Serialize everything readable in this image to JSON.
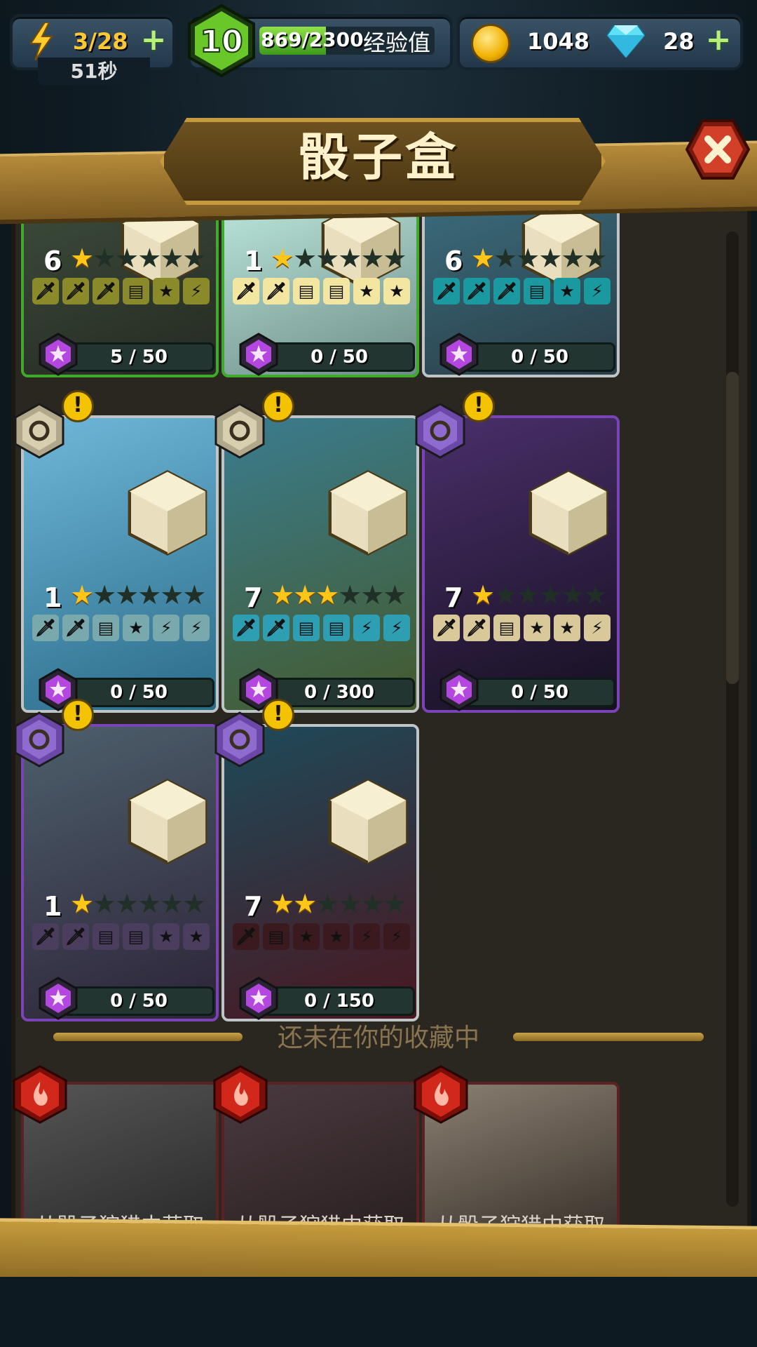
{
  "header": {
    "energy": {
      "value": "3/28",
      "timer": "51秒"
    },
    "level": {
      "number": "10",
      "xp": "869/2300",
      "xp_label": "经验值",
      "xp_progress": 0.378
    },
    "coins": "1048",
    "gems": "28"
  },
  "title": "骰子盒",
  "cards": [
    {
      "level": "6",
      "stars": 1,
      "progress": "5 / 50",
      "faces": [
        "🗡",
        "🗡",
        "🗡",
        "▤",
        "★",
        "⚡"
      ],
      "face_color": "#8a8a2a",
      "border": "green"
    },
    {
      "level": "1",
      "stars": 1,
      "progress": "0 / 50",
      "faces": [
        "🗡",
        "🗡",
        "▤",
        "▤",
        "★",
        "★"
      ],
      "face_color": "#f2e6a0",
      "border": "green"
    },
    {
      "level": "6",
      "stars": 1,
      "progress": "0 / 50",
      "faces": [
        "🗡",
        "🗡",
        "🗡",
        "▤",
        "★",
        "⚡"
      ],
      "face_color": "#1a9aa0",
      "border": "teal"
    },
    {
      "level": "1",
      "stars": 1,
      "progress": "0 / 50",
      "faces": [
        "🗡",
        "🗡",
        "▤",
        "★",
        "⚡",
        "⚡"
      ],
      "face_color": "#7aa9ad",
      "border": "teal"
    },
    {
      "level": "7",
      "stars": 3,
      "progress": "0 / 300",
      "faces": [
        "🗡",
        "🗡",
        "▤",
        "▤",
        "⚡",
        "⚡"
      ],
      "face_color": "#2e9fb3",
      "border": "teal"
    },
    {
      "level": "7",
      "stars": 1,
      "progress": "0 / 50",
      "faces": [
        "🗡",
        "🗡",
        "▤",
        "★",
        "★",
        "⚡"
      ],
      "face_color": "#d9c99a",
      "border": "purple"
    },
    {
      "level": "1",
      "stars": 1,
      "progress": "0 / 50",
      "faces": [
        "🗡",
        "🗡",
        "▤",
        "▤",
        "★",
        "★"
      ],
      "face_color": "#4a3d5e",
      "border": "purple"
    },
    {
      "level": "7",
      "stars": 2,
      "progress": "0 / 150",
      "faces": [
        "🗡",
        "▤",
        "★",
        "★",
        "⚡",
        "⚡"
      ],
      "face_color": "#3a1a1e",
      "border": "teal"
    }
  ],
  "divider_text": "还未在你的收藏中",
  "locked": [
    {
      "text": "从骰子狩猎中获取"
    },
    {
      "text": "从骰子狩猎中获取"
    },
    {
      "text": "从骰子狩猎中获取"
    }
  ]
}
